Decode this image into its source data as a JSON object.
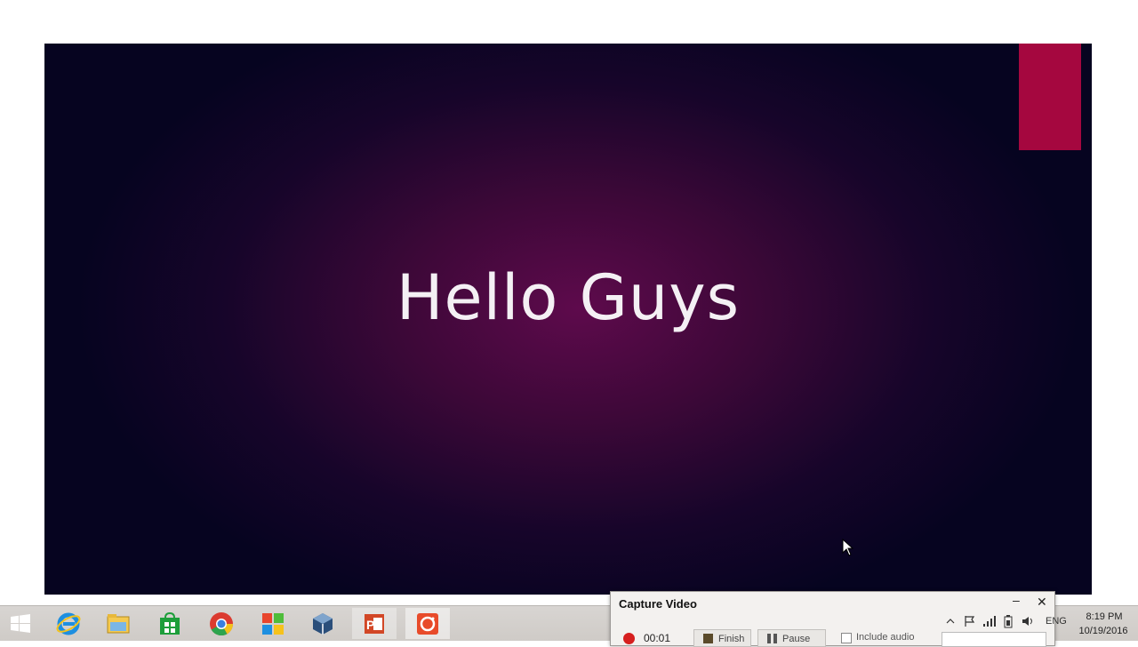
{
  "slide": {
    "title": "Hello Guys",
    "accent_color": "#a5073f",
    "background_center": "#5e0a4c",
    "background_edge": "#060420"
  },
  "taskbar": {
    "apps": [
      {
        "name": "start-icon"
      },
      {
        "name": "internet-explorer-icon"
      },
      {
        "name": "file-explorer-icon"
      },
      {
        "name": "store-icon"
      },
      {
        "name": "chrome-icon"
      },
      {
        "name": "windows-logo-icon"
      },
      {
        "name": "virtualbox-icon"
      },
      {
        "name": "powerpoint-icon"
      },
      {
        "name": "screen-recorder-icon"
      }
    ],
    "tray": {
      "language": "ENG",
      "time": "8:19 PM",
      "date": "10/19/2016"
    }
  },
  "capture_window": {
    "title": "Capture Video",
    "minimize_glyph": "–",
    "close_glyph": "✕",
    "elapsed": "00:01",
    "finish_label": "Finish",
    "pause_label": "Pause",
    "include_audio_label": "Include audio"
  }
}
